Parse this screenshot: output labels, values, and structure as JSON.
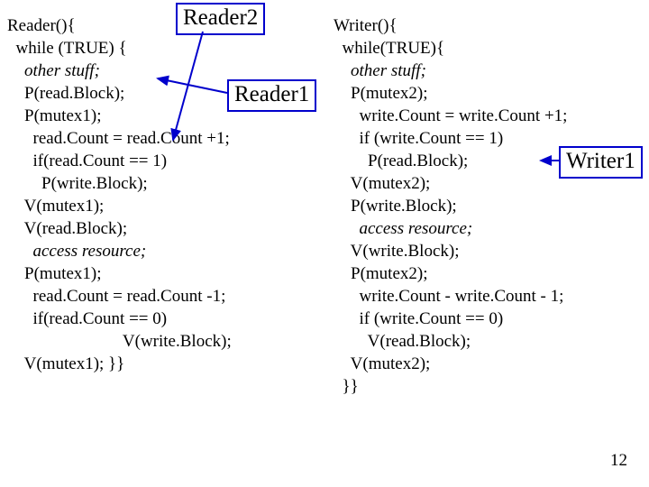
{
  "reader": {
    "l1": "Reader(){",
    "l2": "  while (TRUE) {",
    "l3": "    other stuff;",
    "l4": "    P(read.Block);",
    "l5": "    P(mutex1);",
    "l6": "      read.Count = read.Count +1;",
    "l7": "      if(read.Count == 1)",
    "l8": "        P(write.Block);",
    "l9": "    V(mutex1);",
    "l10": "    V(read.Block);",
    "l11": "      access resource;",
    "l12": "    P(mutex1);",
    "l13": "      read.Count = read.Count -1;",
    "l14": "      if(read.Count == 0)",
    "l15": "                           V(write.Block);",
    "l16": "    V(mutex1); }}"
  },
  "writer": {
    "l1": "Writer(){",
    "l2": "  while(TRUE){",
    "l3": "    other stuff;",
    "l4": "    P(mutex2);",
    "l5": "      write.Count = write.Count +1;",
    "l6": "      if (write.Count == 1)",
    "l7": "        P(read.Block);",
    "l8": "    V(mutex2);",
    "l9": "    P(write.Block);",
    "l10": "      access resource;",
    "l11": "    V(write.Block);",
    "l12": "    P(mutex2);",
    "l13": "      write.Count - write.Count - 1;",
    "l14": "      if (write.Count == 0)",
    "l15": "        V(read.Block);",
    "l16": "    V(mutex2);",
    "l17": "  }}"
  },
  "boxes": {
    "reader2": "Reader2",
    "reader1": "Reader1",
    "writer1": "Writer1"
  },
  "slide_number": "12"
}
